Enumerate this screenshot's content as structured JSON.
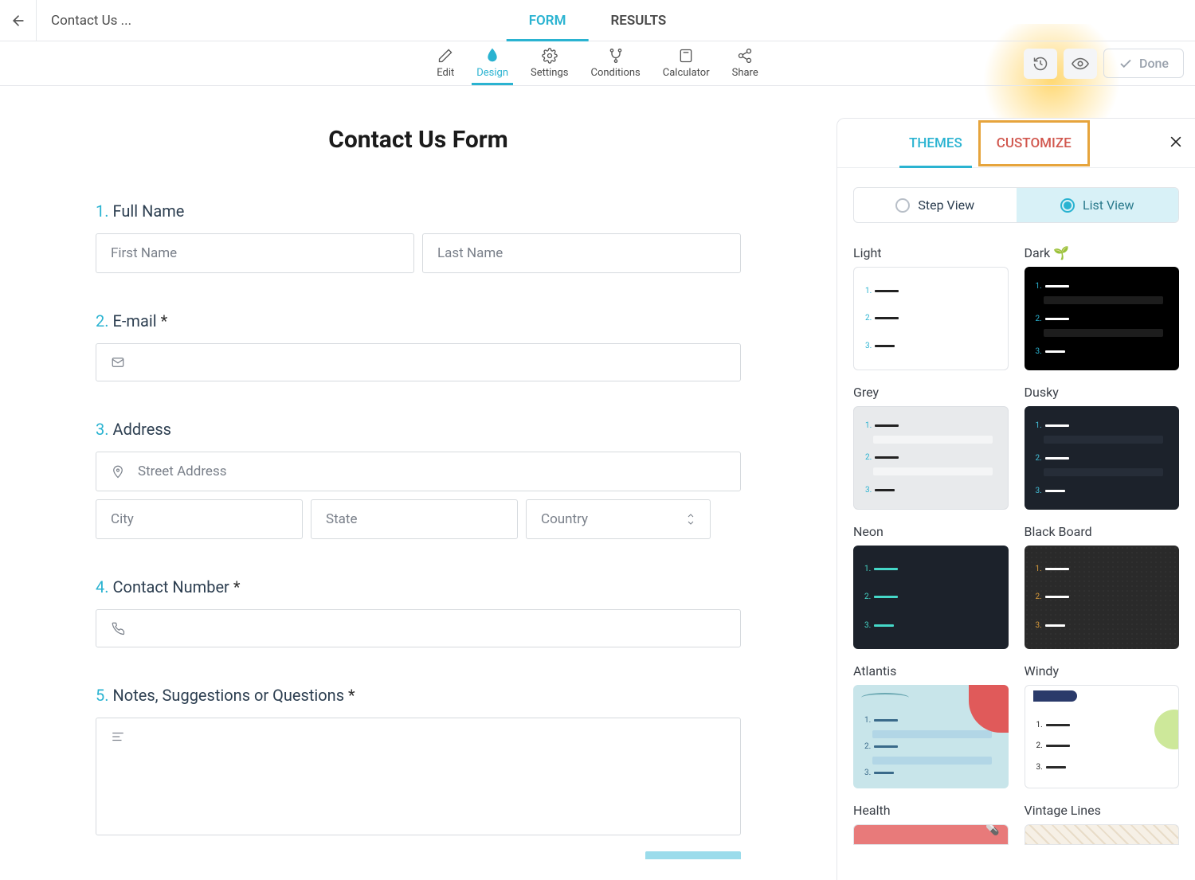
{
  "header": {
    "doc_title": "Contact Us ...",
    "tabs": {
      "form": "FORM",
      "results": "RESULTS"
    }
  },
  "toolbar": {
    "edit": "Edit",
    "design": "Design",
    "settings": "Settings",
    "conditions": "Conditions",
    "calculator": "Calculator",
    "share": "Share",
    "done": "Done"
  },
  "form": {
    "title": "Contact Us Form",
    "q1": {
      "num": "1.",
      "label": "Full Name",
      "first_ph": "First Name",
      "last_ph": "Last Name"
    },
    "q2": {
      "num": "2.",
      "label": "E-mail",
      "required": "*"
    },
    "q3": {
      "num": "3.",
      "label": "Address",
      "street_ph": "Street Address",
      "city_ph": "City",
      "state_ph": "State",
      "country_ph": "Country"
    },
    "q4": {
      "num": "4.",
      "label": "Contact Number",
      "required": "*"
    },
    "q5": {
      "num": "5.",
      "label": "Notes, Suggestions or Questions",
      "required": "*"
    }
  },
  "panel": {
    "tabs": {
      "themes": "THEMES",
      "customize": "CUSTOMIZE"
    },
    "view": {
      "step": "Step View",
      "list": "List View"
    },
    "themes": {
      "light": "Light",
      "dark": "Dark 🌱",
      "grey": "Grey",
      "dusky": "Dusky",
      "neon": "Neon",
      "blackboard": "Black Board",
      "atlantis": "Atlantis",
      "windy": "Windy",
      "health": "Health",
      "vintage": "Vintage Lines"
    }
  }
}
